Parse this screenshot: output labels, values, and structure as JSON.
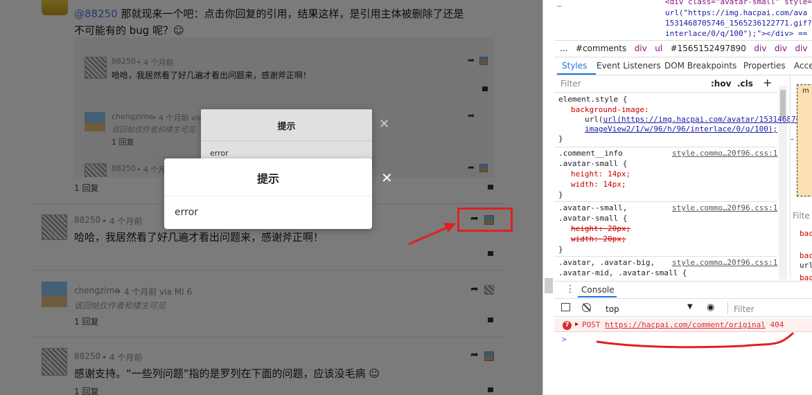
{
  "page": {
    "top_comment": {
      "mention": "@88250",
      "text_line1": " 那就现来一个吧：点击你回复的引用，结果这样，是引用主体被删除了还是",
      "text_line2": "不可能有的 bug 呢？☺"
    },
    "quote": {
      "item1": {
        "user": "88250",
        "time": "• 4 个月前",
        "text": "哈哈，我居然看了好几遍才看出问题来，感谢斧正啊！"
      },
      "item2": {
        "user": "chengzime",
        "time": "• 4 个月前 via MI 6",
        "text": "该回帖仅作者和楼主可见",
        "replies": "1 回复"
      },
      "item3": {
        "user": "88250",
        "time": "• 4 个月前"
      }
    },
    "top_replies": "1 回复",
    "comment1": {
      "user": "88250",
      "time": "• 4 个月前",
      "text": "哈哈，我居然看了好几遍才看出问题来，感谢斧正啊！"
    },
    "comment2": {
      "user": "chengzime",
      "time": "• 4 个月前 via MI 6",
      "text": "该回帖仅作者和楼主可见",
      "replies": "1 回复"
    },
    "comment3": {
      "user": "88250",
      "time": "• 4 个月前",
      "text": "感谢支持。“一些列问题”指的是罗列在下面的问题，应该没毛病 ☺",
      "replies": "1 回复"
    }
  },
  "dialog_back": {
    "title": "提示",
    "body": "error"
  },
  "dialog_front": {
    "title": "提示",
    "body": "error",
    "close": "✕"
  },
  "devtools": {
    "html_lines": [
      "<div class=\"avatar-small\" style=",
      "url(\"https://img.hacpai.com/ava",
      "1531468705746_1565236122771.gif?",
      "interlace/0/q/100\");\"></div> == $"
    ],
    "breadcrumb": [
      "...",
      "#comments",
      "div",
      "ul",
      "#1565152497890",
      "div",
      "div",
      "div",
      "spa"
    ],
    "tabs": [
      "Styles",
      "Event Listeners",
      "DOM Breakpoints",
      "Properties",
      "Acce"
    ],
    "filter_placeholder": "Filter",
    "hov": ":hov",
    "cls": ".cls",
    "plus": "+",
    "styles": {
      "element_style": "element.style {",
      "bg_prop": "background-image:",
      "bg_url1": "url(https://img.hacpai.com/avatar/15314687C",
      "bg_url2": "imageView2/1/w/96/h/96/interlace/0/q/100);",
      "close": "}",
      "rule2_sel1": ".comment__info",
      "rule2_sel2": ".avatar-small {",
      "rule2_src": "style.commo…20f96.css:1",
      "rule2_p1": "height: 14px;",
      "rule2_p2": "width: 14px;",
      "rule3_sel1": ".avatar--small,",
      "rule3_sel2": ".avatar-small {",
      "rule3_src": "style.commo…20f96.css:1",
      "rule3_p1": "height: 20px;",
      "rule3_p2": "width: 20px;",
      "rule4_sel1": ".avatar, .avatar-big,",
      "rule4_sel2": ".avatar-mid, .avatar-small {",
      "rule4_src": "style.commo…20f96.css:1"
    },
    "right_panel": {
      "filter": "Filte",
      "m": "m",
      "dash": "–",
      "items": [
        "bac",
        "bac",
        "url",
        "bac"
      ]
    },
    "console": {
      "tab": "Console",
      "context": "top",
      "filter_placeholder": "Filter",
      "error_count": "7",
      "error_method": "POST",
      "error_url": "https://hacpai.com/comment/original",
      "error_code": "404",
      "prompt": ">"
    }
  },
  "colors": {
    "annotation_red": "#e02020",
    "link_blue": "#4285f4",
    "console_error_bg": "#fff0f0"
  }
}
